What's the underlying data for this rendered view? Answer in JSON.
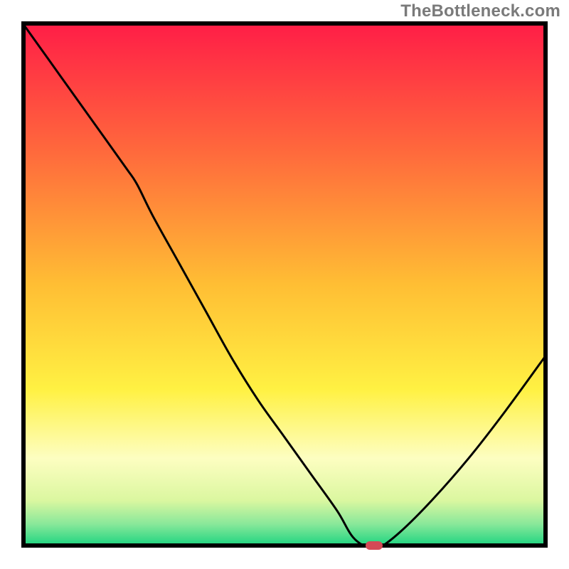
{
  "watermark": "TheBottleneck.com",
  "chart_data": {
    "type": "line",
    "title": "",
    "xlabel": "",
    "ylabel": "",
    "xlim": [
      0,
      100
    ],
    "ylim": [
      0,
      100
    ],
    "x": [
      0,
      5,
      10,
      15,
      20,
      22,
      25,
      30,
      35,
      40,
      45,
      50,
      55,
      60,
      63,
      66,
      68,
      72,
      78,
      85,
      92,
      100
    ],
    "values": [
      100,
      93,
      86,
      79,
      72,
      69,
      63,
      54,
      45,
      36,
      28,
      21,
      14,
      7,
      2,
      0,
      0,
      3,
      9,
      17,
      26,
      37
    ],
    "curve": "smooth",
    "marker_x": 67,
    "gradient_stops": [
      {
        "pos": 0.0,
        "color": "#ff1c47"
      },
      {
        "pos": 0.25,
        "color": "#ff6a3c"
      },
      {
        "pos": 0.5,
        "color": "#ffbe34"
      },
      {
        "pos": 0.7,
        "color": "#fff143"
      },
      {
        "pos": 0.83,
        "color": "#fdfec1"
      },
      {
        "pos": 0.91,
        "color": "#dbf7a0"
      },
      {
        "pos": 0.955,
        "color": "#89e89a"
      },
      {
        "pos": 1.0,
        "color": "#13d27e"
      }
    ],
    "border_color": "#000000",
    "border_width": 6,
    "line_color": "#000000",
    "line_width": 3,
    "marker_color": "#d44a56"
  }
}
